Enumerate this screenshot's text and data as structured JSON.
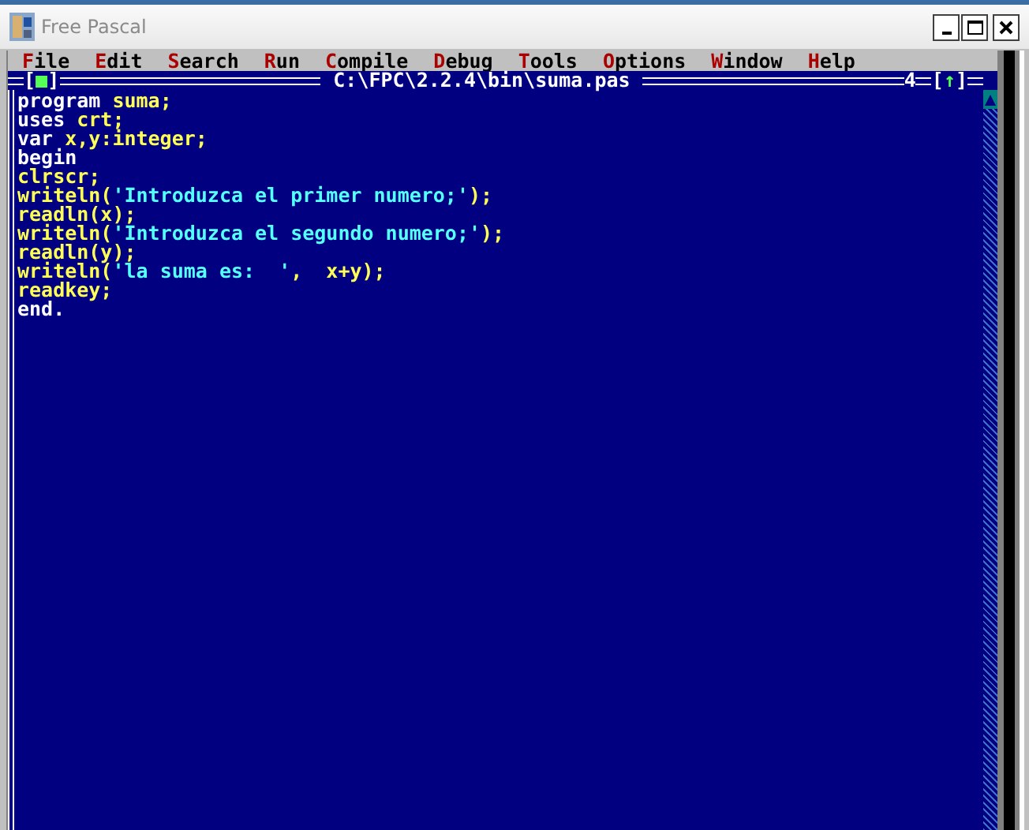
{
  "window": {
    "title": "Free Pascal"
  },
  "menu": [
    {
      "label": "File"
    },
    {
      "label": "Edit"
    },
    {
      "label": "Search"
    },
    {
      "label": "Run"
    },
    {
      "label": "Compile"
    },
    {
      "label": "Debug"
    },
    {
      "label": "Tools"
    },
    {
      "label": "Options"
    },
    {
      "label": "Window"
    },
    {
      "label": "Help"
    }
  ],
  "editor": {
    "close_box": "[■]",
    "title": "C:\\FPC\\2.2.4\\bin\\suma.pas",
    "window_number": "4",
    "zoom_box": "[↑]",
    "lines": [
      [
        {
          "kind": "keyword",
          "text": "program"
        },
        {
          "kind": "ident",
          "text": " suma;"
        }
      ],
      [
        {
          "kind": "keyword",
          "text": "uses"
        },
        {
          "kind": "ident",
          "text": " crt;"
        }
      ],
      [
        {
          "kind": "keyword",
          "text": "var"
        },
        {
          "kind": "ident",
          "text": " x,y:integer;"
        }
      ],
      [
        {
          "kind": "keyword",
          "text": "begin"
        }
      ],
      [
        {
          "kind": "ident",
          "text": "clrscr;"
        }
      ],
      [
        {
          "kind": "ident",
          "text": "writeln("
        },
        {
          "kind": "string",
          "text": "'Introduzca el primer numero;'"
        },
        {
          "kind": "ident",
          "text": ");"
        }
      ],
      [
        {
          "kind": "ident",
          "text": "readln(x);"
        }
      ],
      [
        {
          "kind": "ident",
          "text": "writeln("
        },
        {
          "kind": "string",
          "text": "'Introduzca el segundo numero;'"
        },
        {
          "kind": "ident",
          "text": ");"
        }
      ],
      [
        {
          "kind": "ident",
          "text": "readln(y);"
        }
      ],
      [
        {
          "kind": "ident",
          "text": "writeln("
        },
        {
          "kind": "string",
          "text": "'la suma es:  '"
        },
        {
          "kind": "ident",
          "text": ",  x+y);"
        }
      ],
      [
        {
          "kind": "ident",
          "text": "readkey;"
        }
      ],
      [
        {
          "kind": "keyword",
          "text": "end."
        }
      ]
    ]
  }
}
